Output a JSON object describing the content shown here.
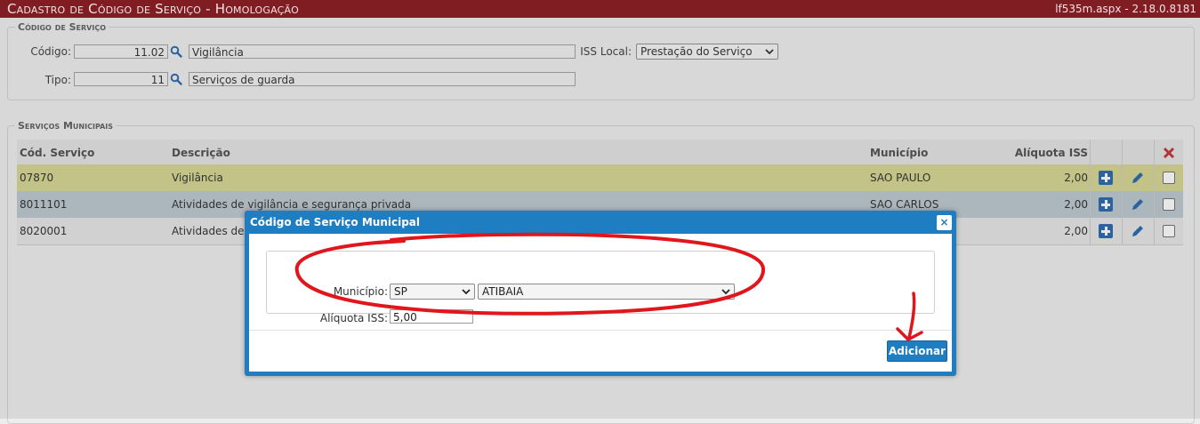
{
  "header": {
    "title": "Cadastro de Código de Serviço  - Homologação",
    "version": "lf535m.aspx - 2.18.0.8181"
  },
  "servico": {
    "legend": "Código de Serviço",
    "codigo_label": "Código:",
    "codigo_value": "11.02",
    "codigo_desc": "Vigilância",
    "tipo_label": "Tipo:",
    "tipo_value": "11",
    "tipo_desc": "Serviços de guarda",
    "iss_local_label": "ISS Local:",
    "iss_local_value": "Prestação do Serviço"
  },
  "municipais": {
    "legend": "Serviços Municipais",
    "columns": [
      "Cód. Serviço",
      "Descrição",
      "Município",
      "Alíquota ISS"
    ],
    "rows": [
      {
        "codigo": "07870",
        "descricao": "Vigilância",
        "municipio": "SAO PAULO",
        "aliquota": "2,00"
      },
      {
        "codigo": "8011101",
        "descricao": "Atividades de vigilância e segurança privada",
        "municipio": "SAO CARLOS",
        "aliquota": "2,00"
      },
      {
        "codigo": "8020001",
        "descricao": "Atividades de m",
        "municipio": "",
        "aliquota": "2,00"
      }
    ]
  },
  "dialog": {
    "title": "Código de Serviço Municipal",
    "close": "×",
    "municipio_label": "Município:",
    "uf_value": "SP",
    "cidade_value": "ATIBAIA",
    "aliquota_label": "Alíquota ISS:",
    "aliquota_value": "5,00",
    "add_button": "Adicionar"
  },
  "colors": {
    "titlebar": "#7f1d22",
    "accent": "#1f7dc1",
    "annotation": "#e0161c",
    "row_highlight": "#d3d38a",
    "row_selected": "#b8c4cc"
  }
}
